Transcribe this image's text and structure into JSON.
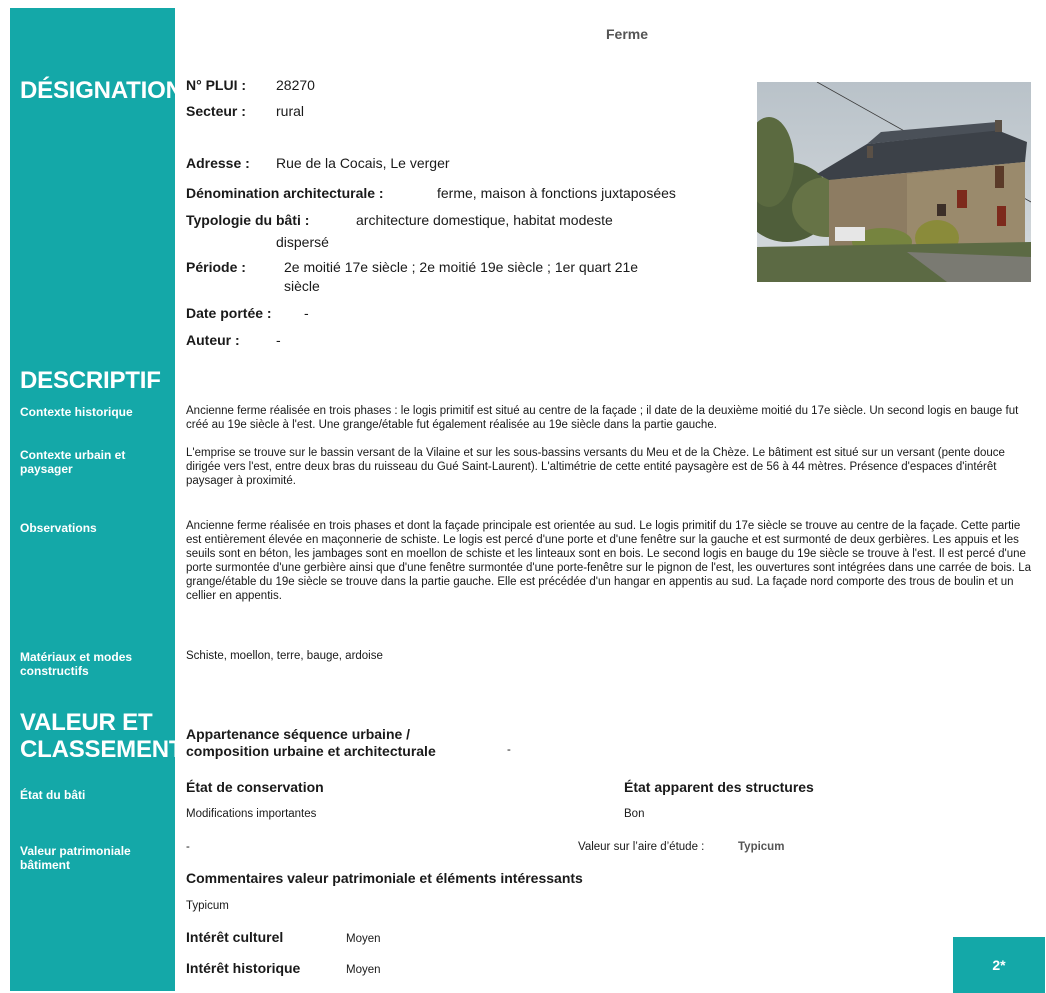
{
  "page_title": "Ferme",
  "sidebar": {
    "designation": "DÉSIGNATION",
    "descriptif": "DESCRIPTIF",
    "contexte_historique": "Contexte historique",
    "contexte_urbain": "Contexte urbain et paysager",
    "observations": "Observations",
    "materiaux": "Matériaux et modes constructifs",
    "valeur_line1": "VALEUR ET",
    "valeur_line2": "CLASSEMENT",
    "etat_bati": "État du bâti",
    "valeur_patrimoniale": "Valeur patrimoniale bâtiment"
  },
  "designation": {
    "plui_label": "N° PLUI :",
    "plui_value": "28270",
    "secteur_label": "Secteur :",
    "secteur_value": "rural",
    "adresse_label": "Adresse :",
    "adresse_value": "Rue de la Cocais, Le verger",
    "denomination_label": "Dénomination architecturale :",
    "denomination_value": "ferme, maison à fonctions juxtaposées",
    "typologie_label": "Typologie du bâti :",
    "typologie_value_1": "architecture domestique, habitat modeste",
    "typologie_value_2": "dispersé",
    "periode_label": "Période :",
    "periode_value_1": "2e moitié 17e siècle ; 2e moitié 19e siècle ; 1er quart 21e",
    "periode_value_2": "siècle",
    "date_label": "Date portée :",
    "date_value": "-",
    "auteur_label": "Auteur :",
    "auteur_value": "-"
  },
  "descriptif": {
    "contexte_historique": "Ancienne ferme réalisée en trois phases : le logis primitif est situé au centre de la façade ; il date de la deuxième moitié du 17e siècle. Un second logis en bauge fut créé au 19e siècle à l'est. Une grange/étable fut également réalisée au 19e siècle dans la partie gauche.",
    "contexte_urbain": "L'emprise se trouve sur le bassin versant de la Vilaine et sur les sous-bassins versants du Meu et de la Chèze. Le bâtiment est situé sur un versant (pente douce dirigée vers l'est, entre deux bras du ruisseau du Gué Saint-Laurent). L'altimétrie de cette entité paysagère est de 56 à 44 mètres. Présence d'espaces d'intérêt paysager à proximité.",
    "observations": "Ancienne ferme réalisée en trois phases et dont la façade principale est orientée au sud. Le logis primitif du 17e siècle se trouve au centre de la façade. Cette partie est entièrement élevée en maçonnerie de schiste. Le logis est percé d'une porte et d'une fenêtre sur la gauche et est surmonté de deux gerbières. Les appuis et les seuils sont en béton, les jambages sont en moellon de schiste et les linteaux sont en bois. Le second logis en bauge du 19e siècle se trouve à l'est. Il est percé d'une porte surmontée d'une gerbière ainsi que d'une fenêtre surmontée d'une porte-fenêtre sur le pignon de l'est, les ouvertures sont intégrées dans une carrée de bois. La grange/étable du 19e siècle se trouve dans la partie gauche. Elle est précédée d'un hangar en appentis au sud. La façade nord comporte des trous de boulin et un cellier en appentis.",
    "materiaux": "Schiste, moellon, terre, bauge, ardoise"
  },
  "valeur": {
    "appartenance_line1": "Appartenance séquence urbaine /",
    "appartenance_line2": "composition urbaine et architecturale",
    "appartenance_value": "-",
    "etat_conservation_label": "État de conservation",
    "etat_conservation_value": "Modifications importantes",
    "etat_structures_label": "État apparent des structures",
    "etat_structures_value": "Bon",
    "valeur_patrimoniale_value": "-",
    "valeur_aire_label": "Valeur sur l’aire d’étude :",
    "valeur_aire_value": "Typicum",
    "commentaires_label": "Commentaires valeur patrimoniale et éléments intéressants",
    "commentaires_value": "Typicum",
    "interet_culturel_label": "Intérêt culturel",
    "interet_culturel_value": "Moyen",
    "interet_historique_label": "Intérêt historique",
    "interet_historique_value": "Moyen"
  },
  "badge": "2*",
  "colors": {
    "sidebar": "#14a8a8",
    "text": "#1a1a1a",
    "title_gray": "#555555"
  }
}
